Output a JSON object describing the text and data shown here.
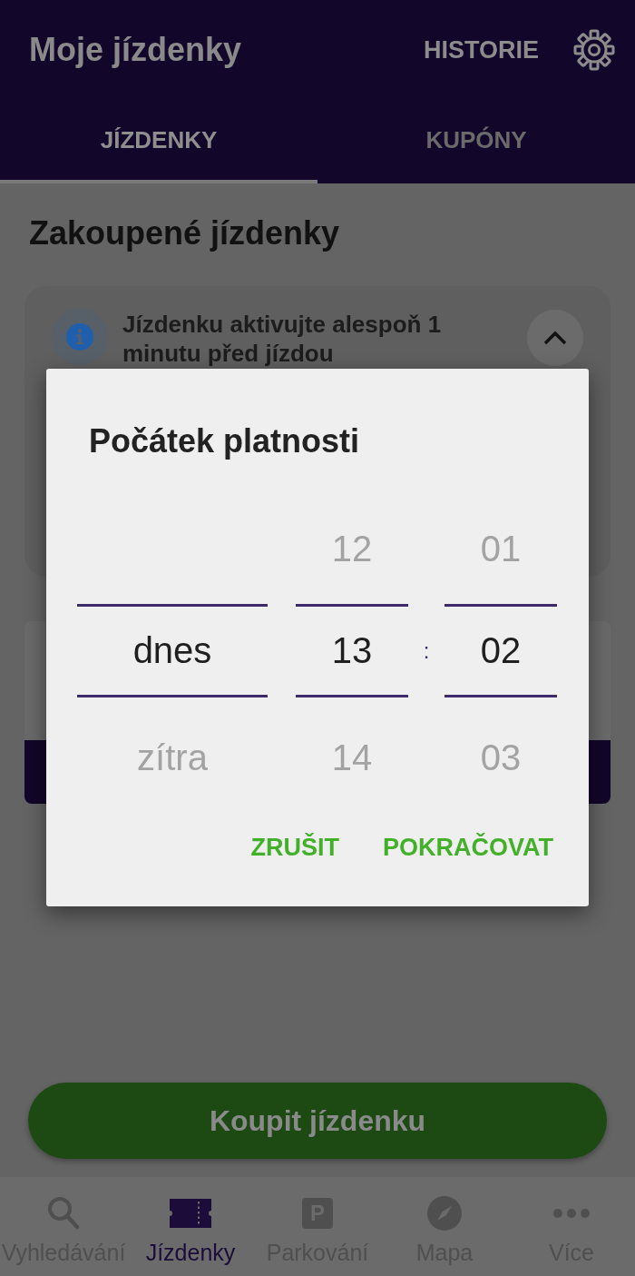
{
  "app_bar": {
    "title": "Moje jízdenky",
    "action": "HISTORIE"
  },
  "tabs": [
    {
      "label": "JÍZDENKY",
      "selected": true
    },
    {
      "label": "KUPÓNY",
      "selected": false
    }
  ],
  "section_title": "Zakoupené jízdenky",
  "info_card": {
    "text": "Jízdenku aktivujte alespoň 1 minutu před jízdou",
    "expanded": true
  },
  "buy_button": "Koupit jízdenku",
  "bottom_nav": [
    {
      "kind": "search",
      "label": "Vyhledávání",
      "selected": false
    },
    {
      "kind": "ticket",
      "label": "Jízdenky",
      "selected": true
    },
    {
      "kind": "parking",
      "badge": "P",
      "label": "Parkování",
      "selected": false
    },
    {
      "kind": "compass",
      "label": "Mapa",
      "selected": false
    },
    {
      "kind": "more",
      "label": "Více",
      "selected": false
    }
  ],
  "dialog": {
    "title": "Počátek platnosti",
    "separator": ":",
    "columns": [
      {
        "kind": "day",
        "options": [
          {
            "label": "dnes",
            "selected": true
          },
          {
            "label": "zítra",
            "selected": false
          }
        ]
      },
      {
        "kind": "hour",
        "options": [
          {
            "label": "12",
            "selected": false
          },
          {
            "label": "13",
            "selected": true
          },
          {
            "label": "14",
            "selected": false
          }
        ]
      },
      {
        "kind": "minute",
        "options": [
          {
            "label": "01",
            "selected": false
          },
          {
            "label": "02",
            "selected": true
          },
          {
            "label": "03",
            "selected": false
          }
        ]
      }
    ],
    "buttons": [
      {
        "label": "ZRUŠIT"
      },
      {
        "label": "POKRAČOVAT"
      }
    ]
  }
}
